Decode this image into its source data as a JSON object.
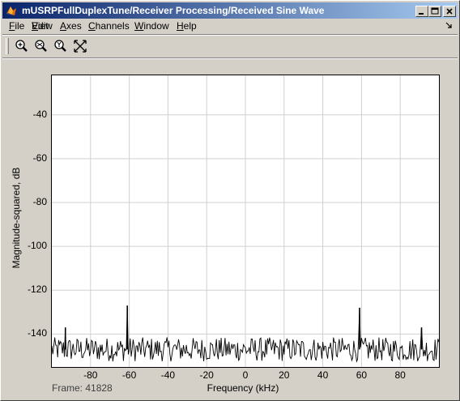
{
  "window": {
    "title": "mUSRPFullDuplexTune/Receiver Processing/Received Sine Wave"
  },
  "menu": [
    "File",
    "Edit",
    "View",
    "Axes",
    "Channels",
    "Window",
    "Help"
  ],
  "toolbar": {
    "tools": [
      "zoom-in-icon",
      "zoom-x-icon",
      "zoom-y-icon",
      "autoscale-icon"
    ]
  },
  "status": {
    "frame_label": "Frame:",
    "frame_value": "41828"
  },
  "chart_data": {
    "type": "line",
    "title": "",
    "xlabel": "Frequency (kHz)",
    "ylabel": "Magnitude-squared, dB",
    "xlim": [
      -100,
      100
    ],
    "ylim": [
      -155,
      -22
    ],
    "xticks": [
      -80,
      -60,
      -40,
      -20,
      0,
      20,
      40,
      60,
      80
    ],
    "yticks": [
      -40,
      -60,
      -80,
      -100,
      -120,
      -140
    ],
    "grid": true,
    "noise_floor_db": -147,
    "peaks": [
      {
        "x": -93,
        "y": -137
      },
      {
        "x": -61,
        "y": -127
      },
      {
        "x": 59,
        "y": -128
      },
      {
        "x": 91,
        "y": -137
      }
    ]
  },
  "colors": {
    "titlebar_start": "#0a246a",
    "titlebar_end": "#a6caf0",
    "face": "#d4d0c8",
    "plot_bg": "#ffffff",
    "grid": "#d0d0d0",
    "trace": "#000000"
  }
}
